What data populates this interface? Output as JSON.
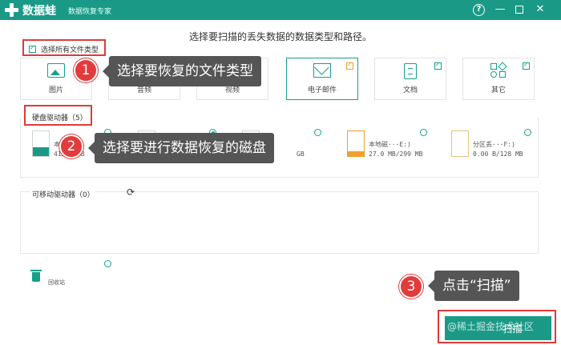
{
  "titlebar": {
    "app_name": "数据蛙",
    "app_subtitle": "数据恢复专家",
    "help": "?",
    "minimize": "—",
    "close": "✕"
  },
  "subtitle": "选择要扫描的丢失数据的数据类型和路径。",
  "select_all": {
    "label": "选择所有文件类型",
    "checked": true
  },
  "types": [
    {
      "label": "图片",
      "checked": false
    },
    {
      "label": "音频",
      "checked": false
    },
    {
      "label": "视频",
      "checked": false
    },
    {
      "label": "电子邮件",
      "checked": true
    },
    {
      "label": "文档",
      "checked": true
    },
    {
      "label": "其它",
      "checked": true
    }
  ],
  "hard_drives": {
    "title": "硬盘驱动器（5）",
    "drives": [
      {
        "name": "本…(C:)",
        "size": "41…20 GB",
        "used_fraction": 0.35,
        "selected": false
      },
      {
        "name": "",
        "size": "",
        "used_fraction": 0.2,
        "selected": false
      },
      {
        "name": "",
        "size": "",
        "used_fraction": 0.2,
        "selected": true
      },
      {
        "name": "",
        "size": "GB",
        "used_fraction": 0.0,
        "selected": false
      },
      {
        "name": "本地磁···E:)",
        "size": "27.0 MB/299 MB",
        "used_fraction": 0.09,
        "selected": false
      },
      {
        "name": "分区丢···F:)",
        "size": "0.00  B/128 MB",
        "used_fraction": 0.0,
        "selected": false
      }
    ]
  },
  "removable": {
    "title": "可移动驱动器（0）"
  },
  "recycle": {
    "label": "回收站"
  },
  "scan_button": {
    "label": "扫描"
  },
  "watermark": "@稀土掘金技术社区",
  "annotations": [
    {
      "number": "1",
      "text": "选择要恢复的文件类型"
    },
    {
      "number": "2",
      "text": "选择要进行数据恢复的磁盘"
    },
    {
      "number": "3",
      "text": "点击“扫描”"
    }
  ],
  "colors": {
    "brand": "#1a9a86",
    "highlight": "#e03a3a",
    "callout_bg": "#555555",
    "badge": "#e23b3b"
  }
}
